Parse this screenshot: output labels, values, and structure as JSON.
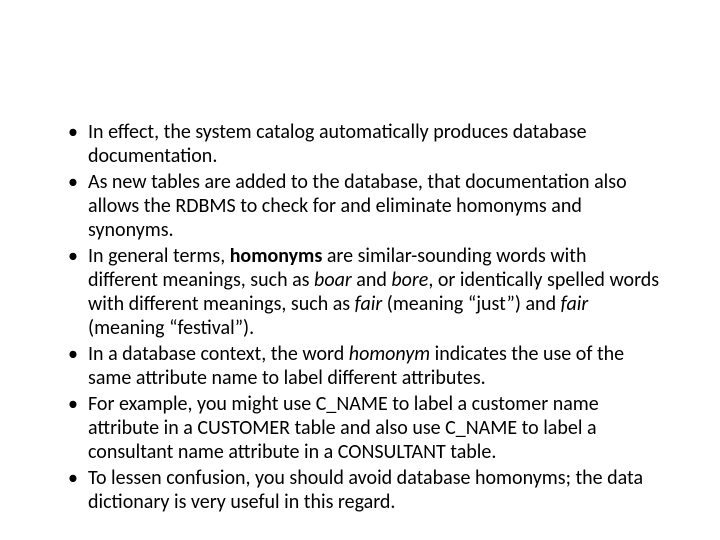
{
  "bullets": [
    {
      "segments": [
        {
          "t": "In effect, the system catalog automatically produces database documentation."
        }
      ]
    },
    {
      "segments": [
        {
          "t": "As new tables are added to the database, that documentation also allows the RDBMS to check for and eliminate homonyms and synonyms."
        }
      ]
    },
    {
      "segments": [
        {
          "t": "In general terms, "
        },
        {
          "t": "homonyms",
          "b": true
        },
        {
          "t": " are similar-sounding words with different meanings, such as "
        },
        {
          "t": "boar",
          "i": true
        },
        {
          "t": " and "
        },
        {
          "t": "bore",
          "i": true
        },
        {
          "t": ", or identically spelled words with different meanings, such as "
        },
        {
          "t": "fair",
          "i": true
        },
        {
          "t": " (meaning “just”) and "
        },
        {
          "t": "fair",
          "i": true
        },
        {
          "t": " (meaning “festival”)."
        }
      ]
    },
    {
      "segments": [
        {
          "t": "In a database context, the word "
        },
        {
          "t": "homonym",
          "i": true
        },
        {
          "t": " indicates the use of the same attribute name to label different attributes."
        }
      ]
    },
    {
      "segments": [
        {
          "t": "For example, you might use C_NAME to label a customer name attribute in a CUSTOMER table and also use C_NAME to label a consultant name attribute in a CONSULTANT table."
        }
      ]
    },
    {
      "segments": [
        {
          "t": "To lessen confusion, you should avoid database homonyms; the data dictionary is very useful in this regard."
        }
      ]
    }
  ]
}
